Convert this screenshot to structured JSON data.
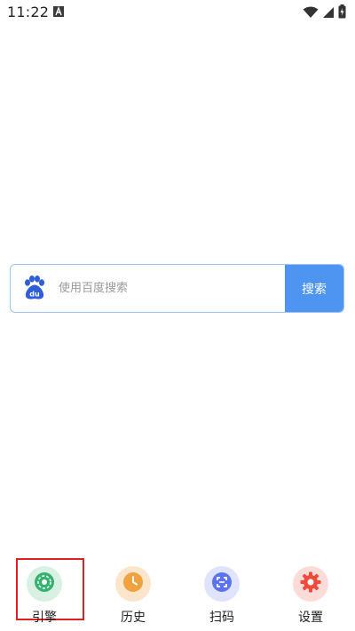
{
  "status_bar": {
    "time": "11:22",
    "app_icon": "a-app-icon",
    "icons": [
      "wifi-icon",
      "signal-icon",
      "battery-icon"
    ]
  },
  "search": {
    "logo": "baidu-paw-icon",
    "placeholder": "使用百度搜索",
    "button_label": "搜索"
  },
  "bottom_nav": {
    "items": [
      {
        "label": "引擎",
        "icon": "engine-icon",
        "color": "#34b36e",
        "bg": "#d8f1e2"
      },
      {
        "label": "历史",
        "icon": "clock-icon",
        "color": "#f0a23f",
        "bg": "#fbe6cc"
      },
      {
        "label": "扫码",
        "icon": "scan-icon",
        "color": "#5b73f0",
        "bg": "#dfe3fb"
      },
      {
        "label": "设置",
        "icon": "gear-icon",
        "color": "#ef4a3a",
        "bg": "#fbdcd8"
      }
    ],
    "selected": "引擎"
  },
  "colors": {
    "accent": "#4e95f2",
    "border": "#9ec3f3",
    "highlight": "#e02020"
  }
}
